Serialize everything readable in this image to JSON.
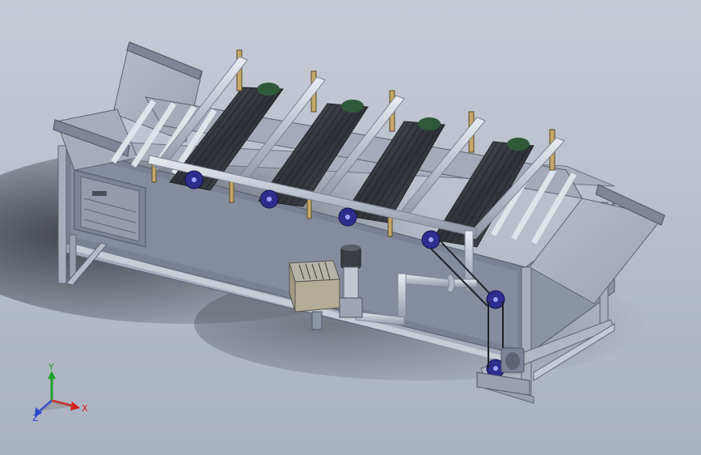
{
  "triad": {
    "x_label": "X",
    "y_label": "Y",
    "z_label": "Z"
  },
  "colors": {
    "background_top": "#c6cbd6",
    "background_bottom": "#aab1bf",
    "frame": "#8f96a8",
    "panel": "#9aa1b3",
    "brush": "#3f4248",
    "pulley": "#2e2e8f",
    "post": "#c4a86a",
    "axis_x": "#d41c1c",
    "axis_y": "#1fa22a",
    "axis_z": "#2b45d2"
  }
}
